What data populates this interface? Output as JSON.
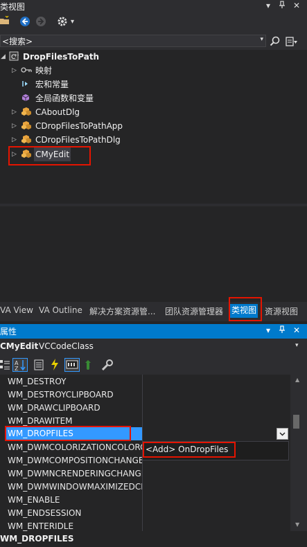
{
  "classview": {
    "title": "类视图",
    "controls": {
      "menu": "▾",
      "pin": "ᵽ",
      "close": "✕"
    },
    "toolbar": {
      "new_folder_icon": "folder-icon",
      "back_icon": "back-icon",
      "forward_icon": "forward-icon",
      "settings_icon": "gear-icon",
      "settings_dropdown": "▾"
    },
    "search": {
      "value": "<搜索>",
      "dropdown": "▾"
    },
    "tree": [
      {
        "label": "DropFilesToPath",
        "icon": "project-icon",
        "expanded": true,
        "bold": true
      },
      {
        "label": "映射",
        "icon": "map-icon",
        "expandable": true
      },
      {
        "label": "宏和常量",
        "icon": "macro-icon"
      },
      {
        "label": "全局函数和变量",
        "icon": "cube-icon"
      },
      {
        "label": "CAboutDlg",
        "icon": "class-icon",
        "expandable": true
      },
      {
        "label": "CDropFilesToPathApp",
        "icon": "class-icon",
        "expandable": true
      },
      {
        "label": "CDropFilesToPathDlg",
        "icon": "class-icon",
        "expandable": true
      },
      {
        "label": "CMyEdit",
        "icon": "class-icon",
        "expandable": true,
        "highlighted": true
      }
    ]
  },
  "tabs": [
    {
      "label": "VA View"
    },
    {
      "label": "VA Outline"
    },
    {
      "label": "解决方案资源管..."
    },
    {
      "label": "团队资源管理器"
    },
    {
      "label": "类视图",
      "active": true
    },
    {
      "label": "资源视图"
    }
  ],
  "properties": {
    "title": "属性",
    "object_name": "CMyEdit",
    "object_type": "VCCodeClass",
    "rows": [
      {
        "name": "WM_DESTROY",
        "value": ""
      },
      {
        "name": "WM_DESTROYCLIPBOARD",
        "value": ""
      },
      {
        "name": "WM_DRAWCLIPBOARD",
        "value": ""
      },
      {
        "name": "WM_DRAWITEM",
        "value": ""
      },
      {
        "name": "WM_DROPFILES",
        "value": "",
        "selected": true
      },
      {
        "name": "WM_DWMCOLORIZATIONCOLORCHANGED",
        "value": ""
      },
      {
        "name": "WM_DWMCOMPOSITIONCHANGED",
        "value": ""
      },
      {
        "name": "WM_DWMNCRENDERINGCHANGED",
        "value": ""
      },
      {
        "name": "WM_DWMWINDOWMAXIMIZEDCHANGE",
        "value": ""
      },
      {
        "name": "WM_ENABLE",
        "value": ""
      },
      {
        "name": "WM_ENDSESSION",
        "value": ""
      },
      {
        "name": "WM_ENTERIDLE",
        "value": ""
      }
    ],
    "dropdown_option": "<Add> OnDropFiles",
    "status": "WM_DROPFILES"
  },
  "colors": {
    "accent": "#007acc",
    "highlight_box": "#e51400",
    "selection": "#3399ff"
  }
}
